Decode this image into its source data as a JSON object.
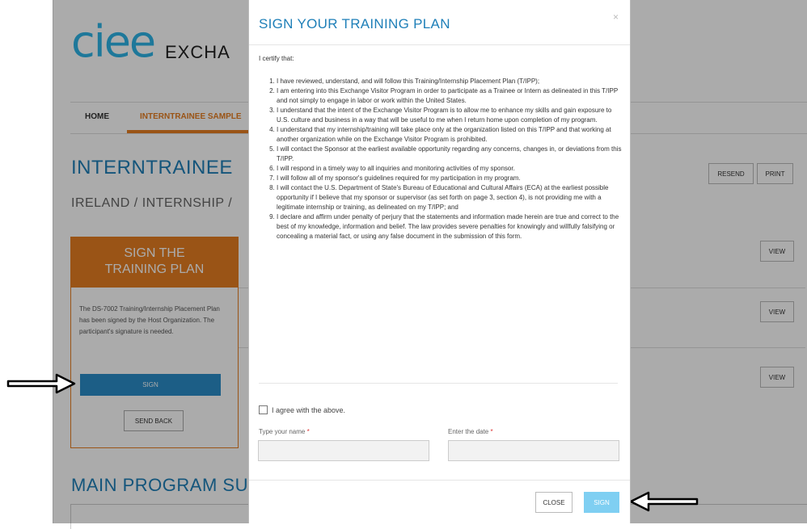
{
  "app": {
    "logo": "ciee",
    "logo_text": "EXCHA",
    "nav": {
      "home": "HOME",
      "sample": "INTERNTRAINEE SAMPLE"
    },
    "main_title": "INTERNTRAINEE",
    "sub_title": "IRELAND / INTERNSHIP /",
    "resend": "RESEND",
    "print": "PRINT",
    "view": "VIEW",
    "main_program": "MAIN PROGRAM SU",
    "sign_card": {
      "line1": "SIGN THE",
      "line2": "TRAINING PLAN",
      "body": "The DS-7002 Training/Internship Placement Plan has been signed by the Host Organization. The participant's signature is needed.",
      "sign": "SIGN",
      "send_back": "SEND BACK"
    }
  },
  "modal": {
    "title": "SIGN YOUR TRAINING PLAN",
    "close_icon": "×",
    "certify": "I certify that:",
    "terms": [
      "I have reviewed, understand, and will follow this Training/Internship Placement Plan (T/IPP);",
      "I am entering into this Exchange Visitor Program in order to participate as a Trainee or Intern as delineated in this T/IPP and not simply to engage in labor or work within the United States.",
      "I understand that the intent of the Exchange Visitor Program is to allow me to enhance my skills and gain exposure to U.S. culture and business in a way that will be useful to me when I return home upon completion of my program.",
      "I understand that my internship/training will take place only at the organization listed on this T/IPP and that working at another organization while on the Exchange Visitor Program is prohibited.",
      "I will contact the Sponsor at the earliest available opportunity regarding any concerns, changes in, or deviations from this T/IPP.",
      "I will respond in a timely way to all inquiries and monitoring activities of my sponsor.",
      "I will follow all of my sponsor's guidelines required for my participation in my program.",
      "I will contact the U.S. Department of State's Bureau of Educational and Cultural Affairs (ECA) at the earliest possible opportunity if I believe that my sponsor or supervisor (as set forth on page 3, section 4), is not providing me with a legitimate internship or training, as delineated on my T/IPP; and",
      "I declare and affirm under penalty of perjury that the statements and information made herein are true and correct to the best of my knowledge, information and belief. The law provides severe penalties for knowingly and willfully falsifying or concealing a material fact, or using any false document in the submission of this form."
    ],
    "agree": "I agree with the above.",
    "name_label": "Type your name",
    "date_label": "Enter the date",
    "required": "*",
    "name_value": "",
    "date_value": "",
    "close": "CLOSE",
    "sign": "SIGN"
  },
  "colors": {
    "accent_blue": "#1e7fb8",
    "orange": "#e67e22",
    "logo_blue": "#2db3e6",
    "sign_button": "#7fcff2"
  },
  "icons": {
    "arrow_left": "arrow-right-icon",
    "arrow_right": "arrow-left-icon"
  }
}
